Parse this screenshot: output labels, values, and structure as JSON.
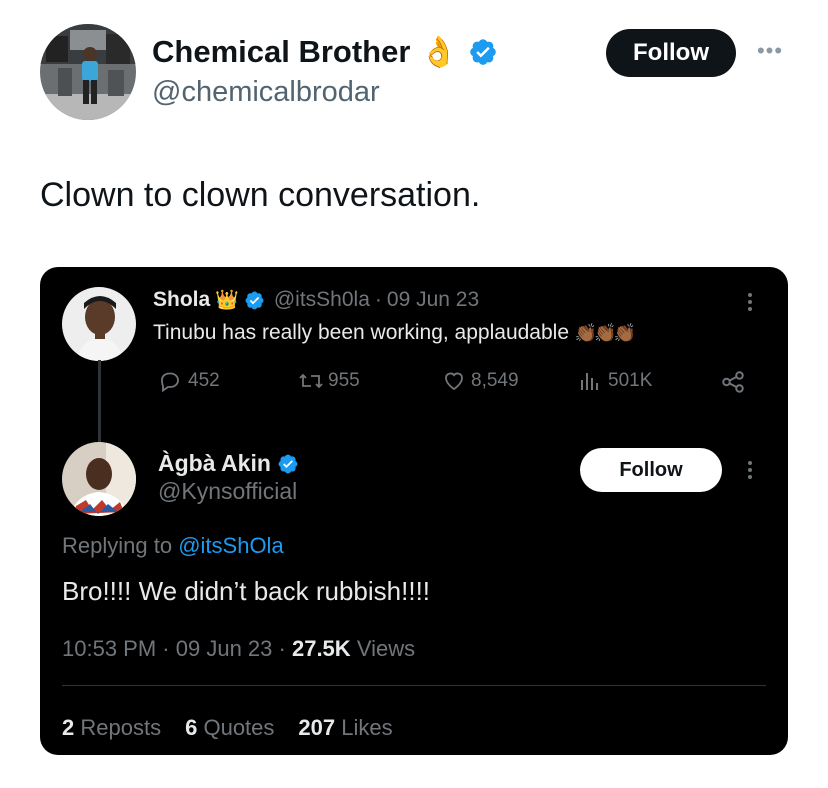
{
  "tweet": {
    "author_name": "Chemical Brother",
    "author_emoji": "👌",
    "author_handle": "@chemicalbrodar",
    "follow_label": "Follow",
    "more_label": "•••",
    "text": "Clown to clown conversation."
  },
  "quoted": {
    "original": {
      "name": "Shola",
      "name_emoji": "👑",
      "handle": "@itsSh0la",
      "dot": "·",
      "date": "09 Jun 23",
      "text": "Tinubu has really been working, applaudable",
      "text_emoji": "👏🏾👏🏾👏🏾",
      "replies": "452",
      "reposts": "955",
      "likes": "8,549",
      "views": "501K"
    },
    "reply": {
      "name": "Àgbà Akin",
      "handle": "@Kynsofficial",
      "follow_label": "Follow",
      "replying_prefix": "Replying to",
      "replying_handle": "@itsShOla",
      "text": "Bro!!!! We didn’t back rubbish!!!!",
      "time": "10:53 PM",
      "dot": "·",
      "date": "09 Jun 23",
      "views_count": "27.5K",
      "views_label": "Views",
      "reposts_count": "2",
      "reposts_label": "Reposts",
      "quotes_count": "6",
      "quotes_label": "Quotes",
      "likes_count": "207",
      "likes_label": "Likes"
    }
  },
  "colors": {
    "verified": "#1d9bf0",
    "link": "#1d9bf0",
    "card_bg": "#000000",
    "muted": "#71767b"
  }
}
